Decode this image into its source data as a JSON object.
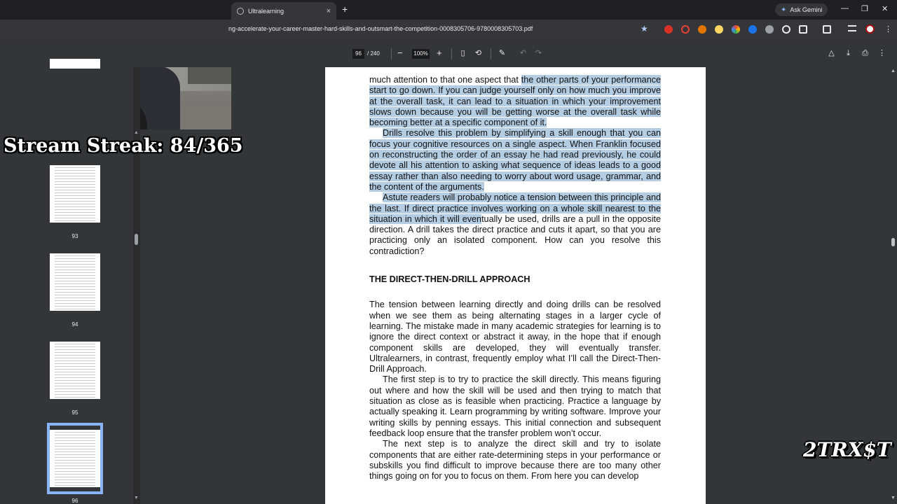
{
  "browser": {
    "tab_title": "Ultralearning",
    "tab_close": "×",
    "new_tab": "+",
    "gemini_label": "Ask Gemini",
    "url": "ng-accelerate-your-career-master-hard-skills-and-outsmart-the-competition-0008305706-9780008305703.pdf",
    "window_minimize": "—",
    "window_restore": "❐",
    "window_close": "✕"
  },
  "pdf_toolbar": {
    "current_page": "96",
    "total_pages": "/ 240",
    "zoom_out": "−",
    "zoom": "100%",
    "zoom_in": "+"
  },
  "thumbnails": [
    {
      "label": "93"
    },
    {
      "label": "94"
    },
    {
      "label": "95"
    },
    {
      "label": "96"
    }
  ],
  "document": {
    "p1_plain": "much attention to that one aspect that ",
    "p1_hl": "the other parts of your performance start to go down. If you can judge yourself only on how much you improve at the overall task, it can lead to a situation in which your improvement slows down because you will be getting worse at the overall task while becoming better at a specific component of it.",
    "p2_hl": "Drills resolve this problem by simplifying a skill enough that you can focus your cognitive resources on a single aspect. When Franklin focused on reconstructing the order of an essay he had read previously, he could devote all his attention to asking what sequence of ideas leads to a good essay rather than also needing to worry about word usage, grammar, and the content of the arguments.",
    "p3_hl": "Astute readers will probably notice a tension between this principle and the last. If direct practice involves working on a whole skill nearest to the situation in which it will even",
    "p3_plain": "tually be used, drills are a pull in the opposite direction. A drill takes the direct practice and cuts it apart, so that you are practicing only an isolated component. How can you resolve this contradiction?",
    "heading": "THE DIRECT-THEN-DRILL APPROACH",
    "p4": "The tension between learning directly and doing drills can be resolved when we see them as being alternating stages in a larger cycle of learning. The mistake made in many academic strategies for learning is to ignore the direct context or abstract it away, in the hope that if enough component skills are developed, they will eventually transfer. Ultralearners, in contrast, frequently employ what I’ll call the Direct-Then-Drill Approach.",
    "p5": "The first step is to try to practice the skill directly. This means figuring out where and how the skill will be used and then trying to match that situation as close as is feasible when practicing. Practice a language by actually speaking it. Learn programming by writing software. Improve your writing skills by penning essays. This initial connection and subsequent feedback loop ensure that the transfer problem won’t occur.",
    "p6": "The next step is to analyze the direct skill and try to isolate components that are either rate-determining steps in your performance or subskills you find difficult to improve because there are too many other things going on for you to focus on them. From here you can develop"
  },
  "overlay": {
    "streak_text": "Stream Streak: 84/365",
    "logo_text": "2TRX$T"
  },
  "colors": {
    "highlight": "#b4cde3",
    "chrome_dark": "#1f2023",
    "toolbar": "#323639",
    "viewer_bg": "#333638",
    "active_thumb_border": "#8ab4f8"
  }
}
